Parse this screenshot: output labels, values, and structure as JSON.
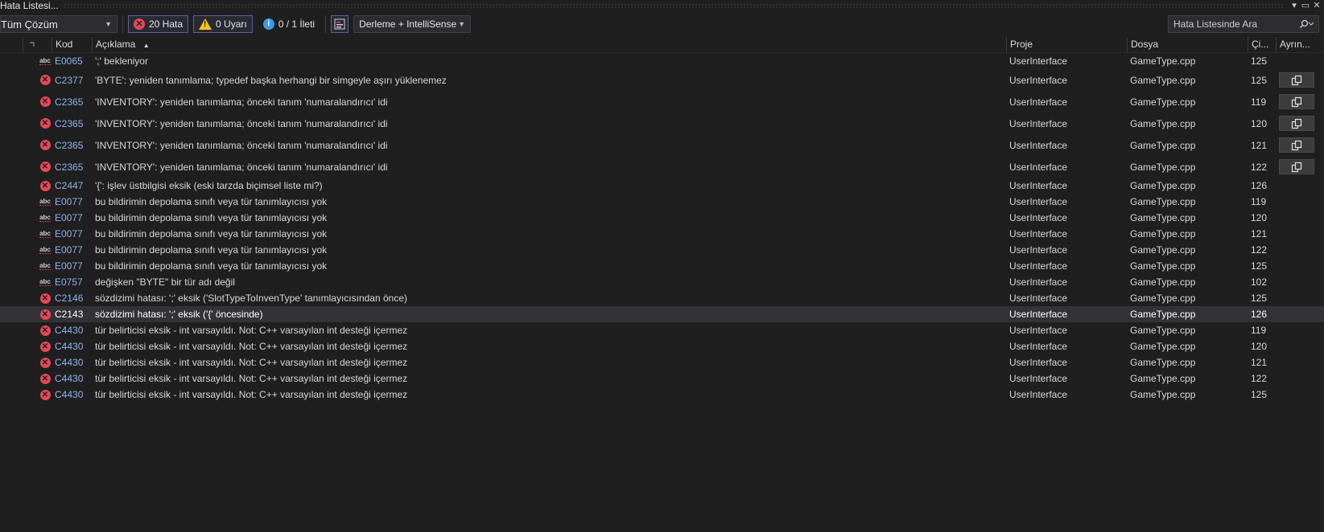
{
  "window": {
    "title": "Hata Listesi..."
  },
  "toolbar": {
    "scope": "Tüm Çözüm",
    "errors_label": "20 Hata",
    "warnings_label": "0 Uyarı",
    "messages_label": "0 / 1 İleti",
    "build_filter": "Derleme + IntelliSense",
    "search_placeholder": "Hata Listesinde Ara"
  },
  "columns": {
    "code": "Kod",
    "description": "Açıklama",
    "project": "Proje",
    "file": "Dosya",
    "line": "Çi...",
    "details": "Ayrın..."
  },
  "rows": [
    {
      "severity": "abc",
      "code": "E0065",
      "description": "';' bekleniyor",
      "project": "UserInterface",
      "file": "GameType.cpp",
      "line": "125",
      "has_detail": false
    },
    {
      "severity": "error",
      "code": "C2377",
      "description": "'BYTE': yeniden tanımlama; typedef başka herhangi bir simgeyle aşırı yüklenemez",
      "project": "UserInterface",
      "file": "GameType.cpp",
      "line": "125",
      "has_detail": true
    },
    {
      "severity": "error",
      "code": "C2365",
      "description": "'INVENTORY': yeniden tanımlama; önceki tanım 'numaralandırıcı' idi",
      "project": "UserInterface",
      "file": "GameType.cpp",
      "line": "119",
      "has_detail": true
    },
    {
      "severity": "error",
      "code": "C2365",
      "description": "'INVENTORY': yeniden tanımlama; önceki tanım 'numaralandırıcı' idi",
      "project": "UserInterface",
      "file": "GameType.cpp",
      "line": "120",
      "has_detail": true
    },
    {
      "severity": "error",
      "code": "C2365",
      "description": "'INVENTORY': yeniden tanımlama; önceki tanım 'numaralandırıcı' idi",
      "project": "UserInterface",
      "file": "GameType.cpp",
      "line": "121",
      "has_detail": true
    },
    {
      "severity": "error",
      "code": "C2365",
      "description": "'INVENTORY': yeniden tanımlama; önceki tanım 'numaralandırıcı' idi",
      "project": "UserInterface",
      "file": "GameType.cpp",
      "line": "122",
      "has_detail": true
    },
    {
      "severity": "error",
      "code": "C2447",
      "description": "'{': işlev üstbilgisi eksik (eski tarzda biçimsel liste mi?)",
      "project": "UserInterface",
      "file": "GameType.cpp",
      "line": "126",
      "has_detail": false
    },
    {
      "severity": "abc",
      "code": "E0077",
      "description": "bu bildirimin depolama sınıfı veya tür tanımlayıcısı yok",
      "project": "UserInterface",
      "file": "GameType.cpp",
      "line": "119",
      "has_detail": false
    },
    {
      "severity": "abc",
      "code": "E0077",
      "description": "bu bildirimin depolama sınıfı veya tür tanımlayıcısı yok",
      "project": "UserInterface",
      "file": "GameType.cpp",
      "line": "120",
      "has_detail": false
    },
    {
      "severity": "abc",
      "code": "E0077",
      "description": "bu bildirimin depolama sınıfı veya tür tanımlayıcısı yok",
      "project": "UserInterface",
      "file": "GameType.cpp",
      "line": "121",
      "has_detail": false
    },
    {
      "severity": "abc",
      "code": "E0077",
      "description": "bu bildirimin depolama sınıfı veya tür tanımlayıcısı yok",
      "project": "UserInterface",
      "file": "GameType.cpp",
      "line": "122",
      "has_detail": false
    },
    {
      "severity": "abc",
      "code": "E0077",
      "description": "bu bildirimin depolama sınıfı veya tür tanımlayıcısı yok",
      "project": "UserInterface",
      "file": "GameType.cpp",
      "line": "125",
      "has_detail": false
    },
    {
      "severity": "abc",
      "code": "E0757",
      "description": "değişken \"BYTE\" bir tür adı değil",
      "project": "UserInterface",
      "file": "GameType.cpp",
      "line": "102",
      "has_detail": false
    },
    {
      "severity": "error",
      "code": "C2146",
      "description": "sözdizimi hatası: ';' eksik ('SlotTypeToInvenType' tanımlayıcısından önce)",
      "project": "UserInterface",
      "file": "GameType.cpp",
      "line": "125",
      "has_detail": false
    },
    {
      "severity": "error",
      "code": "C2143",
      "description": "sözdizimi hatası: ';' eksik ('{' öncesinde)",
      "project": "UserInterface",
      "file": "GameType.cpp",
      "line": "126",
      "has_detail": false,
      "selected": true
    },
    {
      "severity": "error",
      "code": "C4430",
      "description": "tür belirticisi eksik - int varsayıldı. Not: C++ varsayılan int desteği içermez",
      "project": "UserInterface",
      "file": "GameType.cpp",
      "line": "119",
      "has_detail": false
    },
    {
      "severity": "error",
      "code": "C4430",
      "description": "tür belirticisi eksik - int varsayıldı. Not: C++ varsayılan int desteği içermez",
      "project": "UserInterface",
      "file": "GameType.cpp",
      "line": "120",
      "has_detail": false
    },
    {
      "severity": "error",
      "code": "C4430",
      "description": "tür belirticisi eksik - int varsayıldı. Not: C++ varsayılan int desteği içermez",
      "project": "UserInterface",
      "file": "GameType.cpp",
      "line": "121",
      "has_detail": false
    },
    {
      "severity": "error",
      "code": "C4430",
      "description": "tür belirticisi eksik - int varsayıldı. Not: C++ varsayılan int desteği içermez",
      "project": "UserInterface",
      "file": "GameType.cpp",
      "line": "122",
      "has_detail": false
    },
    {
      "severity": "error",
      "code": "C4430",
      "description": "tür belirticisi eksik - int varsayıldı. Not: C++ varsayılan int desteği içermez",
      "project": "UserInterface",
      "file": "GameType.cpp",
      "line": "125",
      "has_detail": false
    }
  ],
  "icons": {
    "error": "error-circle-icon",
    "intellisense": "spell-check-abc-icon",
    "detail": "copy-details-icon"
  },
  "colors": {
    "background": "#1f1f1f",
    "error": "#e8475a",
    "warning": "#f5c518",
    "info": "#3e9ae8",
    "code_link": "#8cb4f0",
    "selected_row": "#333337"
  }
}
